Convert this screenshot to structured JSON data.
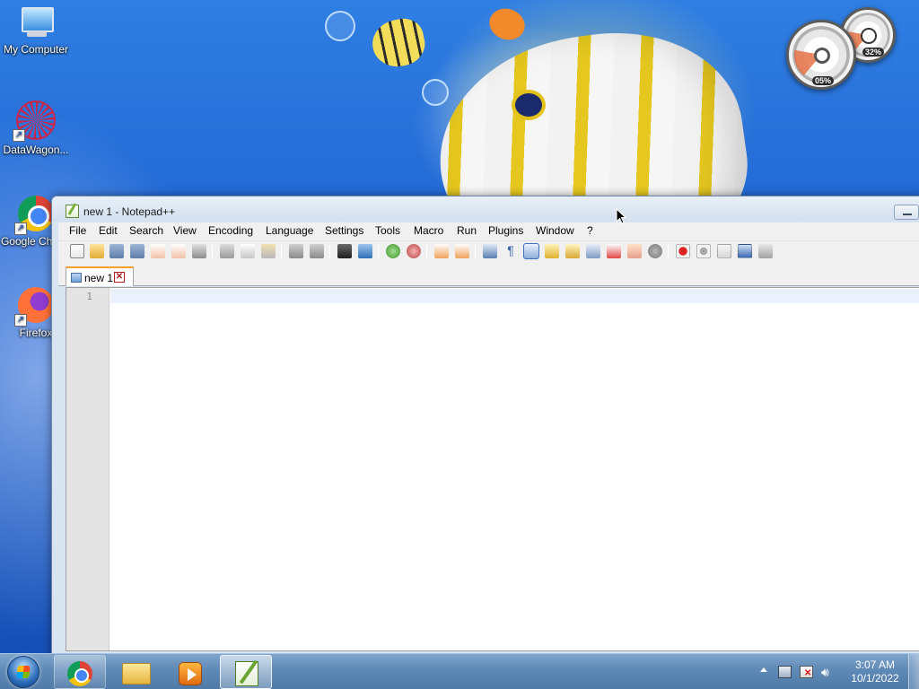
{
  "desktop": {
    "icons": [
      {
        "label": "My Computer"
      },
      {
        "label": "DataWagon..."
      },
      {
        "label": "Google Chrom"
      },
      {
        "label": "Firefox"
      }
    ],
    "gadget": {
      "cpu_value": "05%",
      "mem_value": "32%"
    }
  },
  "window": {
    "title": "new 1 - Notepad++",
    "menu": [
      "File",
      "Edit",
      "Search",
      "View",
      "Encoding",
      "Language",
      "Settings",
      "Tools",
      "Macro",
      "Run",
      "Plugins",
      "Window",
      "?"
    ],
    "toolbar_icons": [
      "new-file-icon",
      "open-file-icon",
      "save-icon",
      "save-all-icon",
      "close-icon",
      "close-all-icon",
      "print-icon",
      "cut-icon",
      "copy-icon",
      "paste-icon",
      "undo-icon",
      "redo-icon",
      "find-icon",
      "replace-icon",
      "zoom-in-icon",
      "zoom-out-icon",
      "sync-vertical-icon",
      "sync-horizontal-icon",
      "word-wrap-icon",
      "show-all-characters-icon",
      "indent-guide-icon",
      "user-defined-language-icon",
      "document-map-icon",
      "function-list-icon",
      "folder-as-workspace-icon",
      "doc-switcher-icon",
      "record-macro-icon",
      "stop-recording-icon",
      "playback-macro-icon",
      "run-macro-multiple-icon",
      "save-macro-icon"
    ],
    "tab": {
      "label": "new 1",
      "close_glyph": "✕"
    },
    "editor": {
      "line_numbers": [
        "1"
      ]
    }
  },
  "taskbar": {
    "apps": [
      "chrome-icon",
      "file-explorer-icon",
      "media-player-icon",
      "notepadpp-icon"
    ],
    "active_app": "notepadpp-icon",
    "time": "3:07 AM",
    "date": "10/1/2022"
  }
}
